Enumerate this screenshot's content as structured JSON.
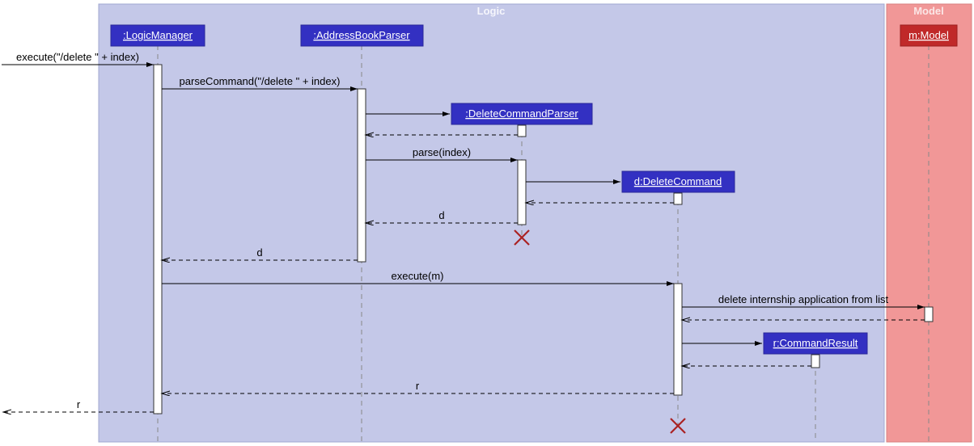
{
  "regions": {
    "logic": {
      "title": "Logic"
    },
    "model": {
      "title": "Model"
    }
  },
  "lifelines": {
    "logicManager": {
      "label": ":LogicManager"
    },
    "addressBookParser": {
      "label": ":AddressBookParser"
    },
    "deleteCommandParser": {
      "label": ":DeleteCommandParser"
    },
    "deleteCommand": {
      "label": "d:DeleteCommand"
    },
    "commandResult": {
      "label": "r:CommandResult"
    },
    "model": {
      "label": "m:Model"
    }
  },
  "messages": {
    "m1": "execute(\"/delete \" + index)",
    "m2": "parseCommand(\"/delete \" + index)",
    "m3": "parse(index)",
    "m4": "d",
    "m5": "d",
    "m6": "execute(m)",
    "m7": "delete internship application from list",
    "m8": "r",
    "m9": "r"
  },
  "chart_data": {
    "type": "sequence-diagram",
    "regions": [
      {
        "name": "Logic",
        "participants": [
          "LogicManager",
          "AddressBookParser",
          "DeleteCommandParser",
          "DeleteCommand",
          "CommandResult"
        ]
      },
      {
        "name": "Model",
        "participants": [
          "Model"
        ]
      }
    ],
    "participants": [
      {
        "id": "LogicManager",
        "label": ":LogicManager",
        "created_at_start": true
      },
      {
        "id": "AddressBookParser",
        "label": ":AddressBookParser",
        "created_at_start": true
      },
      {
        "id": "DeleteCommandParser",
        "label": ":DeleteCommandParser",
        "created_at_start": false,
        "destroyed": true
      },
      {
        "id": "DeleteCommand",
        "label": "d:DeleteCommand",
        "created_at_start": false,
        "destroyed": true
      },
      {
        "id": "CommandResult",
        "label": "r:CommandResult",
        "created_at_start": false
      },
      {
        "id": "Model",
        "label": "m:Model",
        "created_at_start": true
      }
    ],
    "messages": [
      {
        "from": "caller",
        "to": "LogicManager",
        "text": "execute(\"/delete \" + index)",
        "type": "sync"
      },
      {
        "from": "LogicManager",
        "to": "AddressBookParser",
        "text": "parseCommand(\"/delete \" + index)",
        "type": "sync"
      },
      {
        "from": "AddressBookParser",
        "to": "DeleteCommandParser",
        "text": "",
        "type": "create"
      },
      {
        "from": "DeleteCommandParser",
        "to": "AddressBookParser",
        "text": "",
        "type": "return"
      },
      {
        "from": "AddressBookParser",
        "to": "DeleteCommandParser",
        "text": "parse(index)",
        "type": "sync"
      },
      {
        "from": "DeleteCommandParser",
        "to": "DeleteCommand",
        "text": "",
        "type": "create"
      },
      {
        "from": "DeleteCommand",
        "to": "DeleteCommandParser",
        "text": "",
        "type": "return"
      },
      {
        "from": "DeleteCommandParser",
        "to": "AddressBookParser",
        "text": "d",
        "type": "return"
      },
      {
        "from": "AddressBookParser",
        "to": "LogicManager",
        "text": "d",
        "type": "return"
      },
      {
        "from": "LogicManager",
        "to": "DeleteCommand",
        "text": "execute(m)",
        "type": "sync"
      },
      {
        "from": "DeleteCommand",
        "to": "Model",
        "text": "delete internship application from list",
        "type": "sync"
      },
      {
        "from": "Model",
        "to": "DeleteCommand",
        "text": "",
        "type": "return"
      },
      {
        "from": "DeleteCommand",
        "to": "CommandResult",
        "text": "",
        "type": "create"
      },
      {
        "from": "CommandResult",
        "to": "DeleteCommand",
        "text": "",
        "type": "return"
      },
      {
        "from": "DeleteCommand",
        "to": "LogicManager",
        "text": "r",
        "type": "return"
      },
      {
        "from": "LogicManager",
        "to": "caller",
        "text": "r",
        "type": "return"
      }
    ]
  }
}
